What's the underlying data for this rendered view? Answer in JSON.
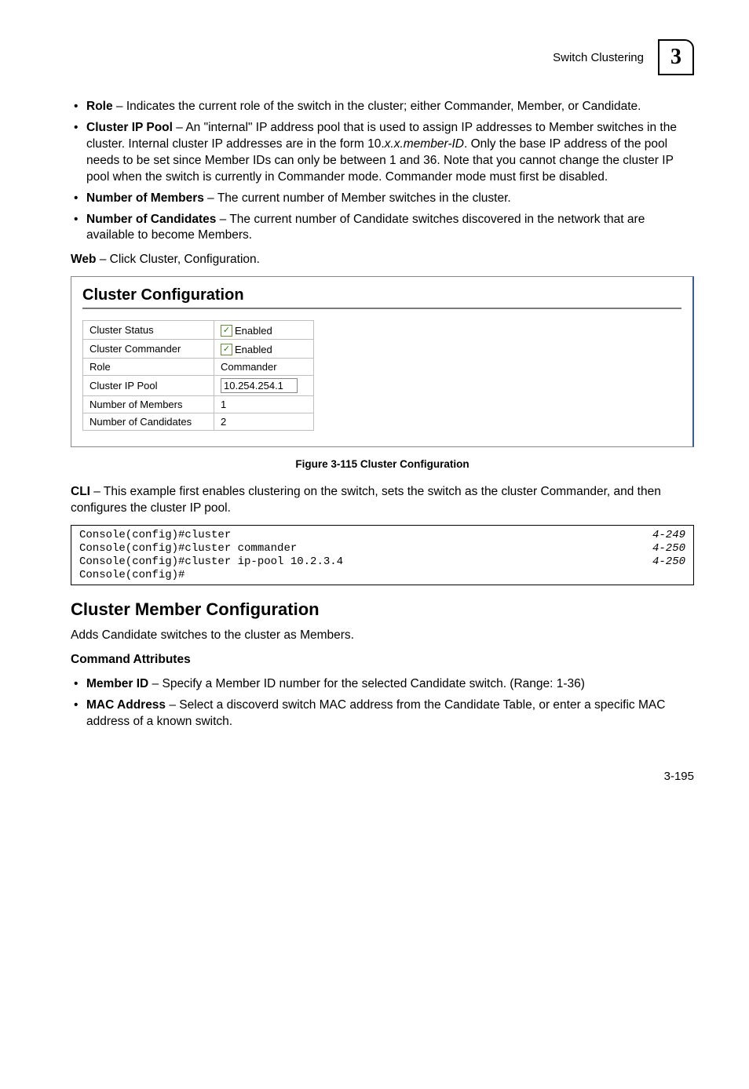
{
  "header": {
    "label": "Switch Clustering",
    "chapter": "3"
  },
  "bullets1": [
    {
      "term": "Role",
      "text": " – Indicates the current role of the switch in the cluster; either Commander, Member, or Candidate."
    },
    {
      "term": "Cluster IP Pool",
      "text_part1": " – An \"internal\" IP address pool that is used to assign IP addresses to Member switches in the cluster. Internal cluster IP addresses are in the form 10.",
      "italic": "x.x.member-ID",
      "text_part2": ". Only the base IP address of the pool needs to be set since Member IDs can only be between 1 and 36. Note that you cannot change the cluster IP pool when the switch is currently in Commander mode. Commander mode must first be disabled."
    },
    {
      "term": "Number of Members",
      "text": " – The current number of Member switches in the cluster."
    },
    {
      "term": "Number of Candidates",
      "text": " – The current number of Candidate switches discovered in the network that are available to become Members."
    }
  ],
  "web_line": {
    "bold": "Web",
    "rest": " – Click Cluster, Configuration."
  },
  "figure": {
    "title": "Cluster Configuration",
    "rows": [
      {
        "label": "Cluster Status",
        "type": "checkbox",
        "checked": true,
        "text": "Enabled"
      },
      {
        "label": "Cluster Commander",
        "type": "checkbox",
        "checked": true,
        "text": "Enabled"
      },
      {
        "label": "Role",
        "type": "text",
        "value": "Commander"
      },
      {
        "label": "Cluster IP Pool",
        "type": "input",
        "value": "10.254.254.1"
      },
      {
        "label": "Number of Members",
        "type": "text",
        "value": "1"
      },
      {
        "label": "Number of Candidates",
        "type": "text",
        "value": "2"
      }
    ]
  },
  "caption": "Figure 3-115  Cluster Configuration",
  "cli_text": {
    "bold": "CLI",
    "rest": " – This example first enables clustering on the switch, sets the switch as the cluster Commander, and then configures the cluster IP pool."
  },
  "code": [
    {
      "cmd": "Console(config)#cluster",
      "ref": "4-249"
    },
    {
      "cmd": "Console(config)#cluster commander",
      "ref": "4-250"
    },
    {
      "cmd": "Console(config)#cluster ip-pool 10.2.3.4",
      "ref": "4-250"
    },
    {
      "cmd": "Console(config)#",
      "ref": ""
    }
  ],
  "section2": {
    "heading": "Cluster Member Configuration",
    "intro": "Adds Candidate switches to the cluster as Members.",
    "attr_heading": "Command Attributes",
    "bullets": [
      {
        "term": "Member ID",
        "text": " – Specify a Member ID number for the selected Candidate switch. (Range: 1-36)"
      },
      {
        "term": "MAC Address",
        "text": " – Select a discoverd switch MAC address from the Candidate Table, or enter a specific MAC address of a known switch."
      }
    ]
  },
  "footer": "3-195"
}
